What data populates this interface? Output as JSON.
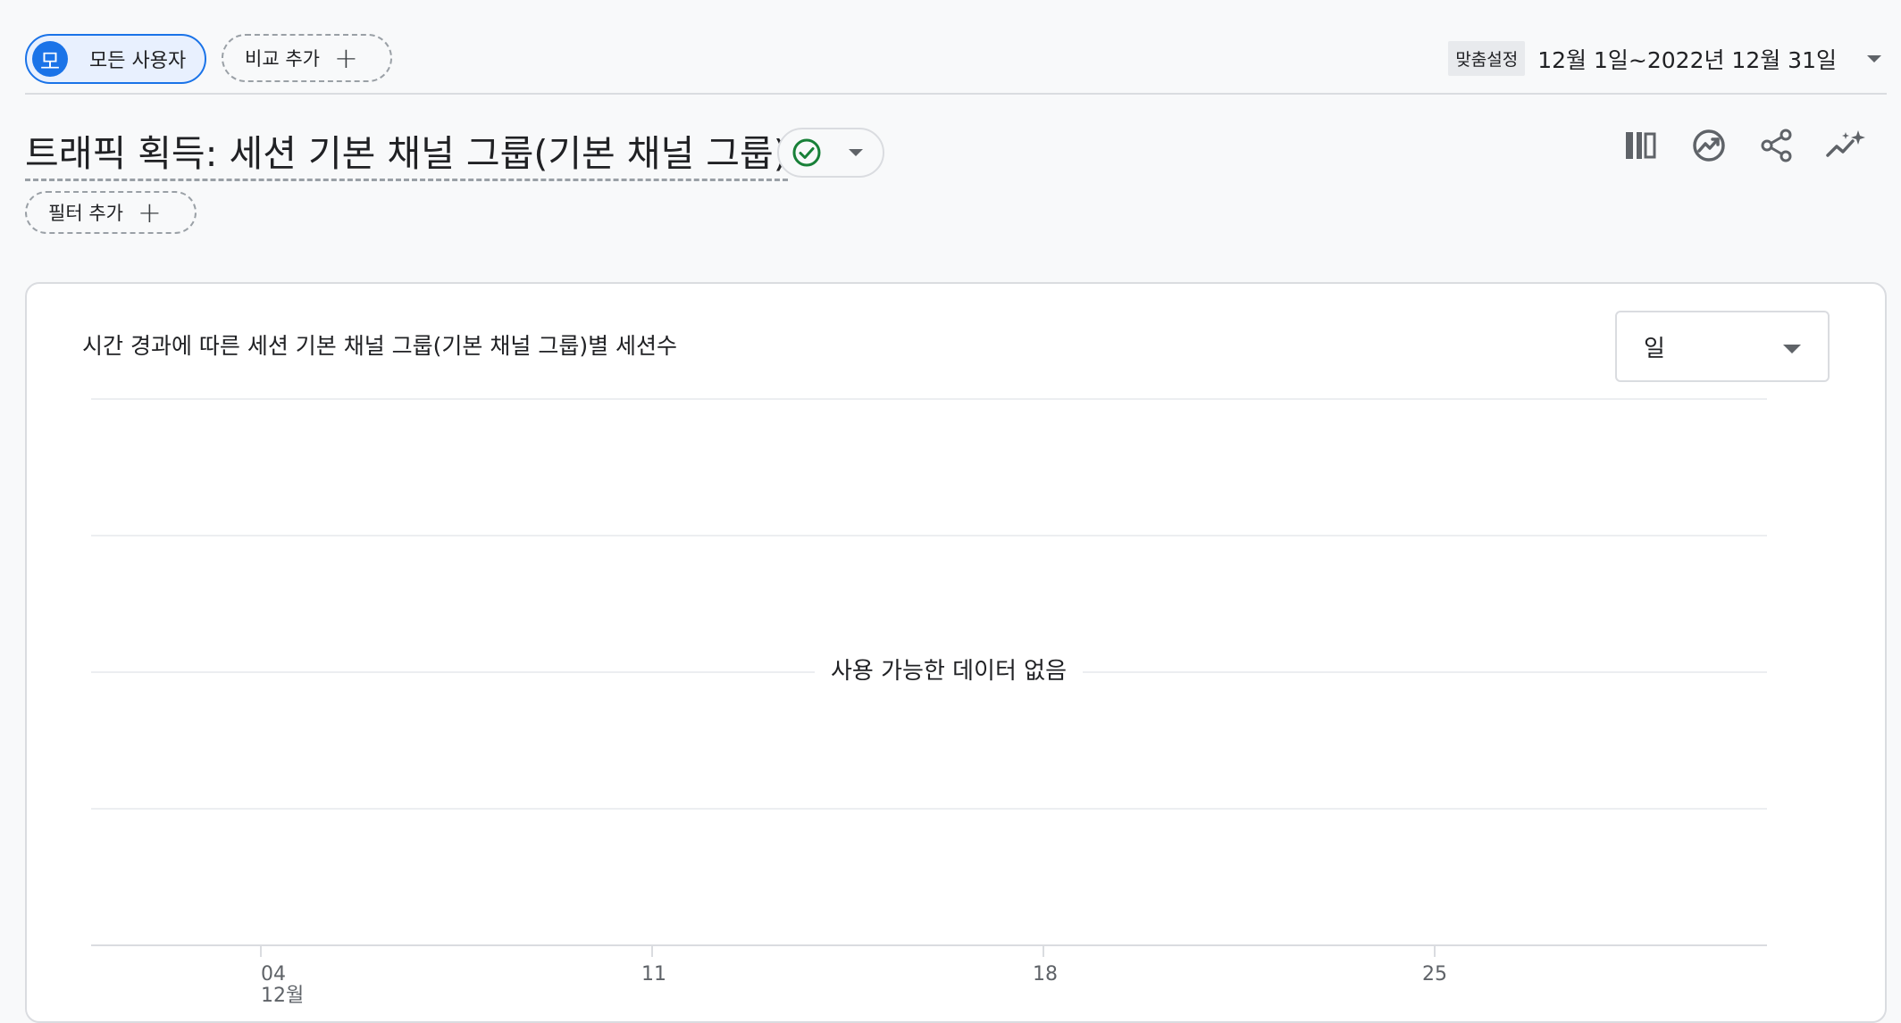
{
  "header": {
    "user_chip": {
      "avatar_letter": "모",
      "label": "모든 사용자"
    },
    "compare_chip": {
      "label": "비교 추가",
      "icon": "plus-icon"
    },
    "date_range": {
      "badge": "맞춤설정",
      "text": "12월 1일~2022년 12월 31일",
      "icon": "chevron-down-icon"
    }
  },
  "title_row": {
    "title": "트래픽 획득: 세션 기본 채널 그룹(기본 채널 그룹)",
    "status_icon": "check-circle-icon",
    "actions": [
      {
        "name": "customize-report-icon"
      },
      {
        "name": "insights-icon"
      },
      {
        "name": "share-icon"
      },
      {
        "name": "sparkle-trend-icon"
      }
    ]
  },
  "filter_chip": {
    "label": "필터 추가",
    "icon": "plus-icon"
  },
  "card": {
    "title": "시간 경과에 따른 세션 기본 채널 그룹(기본 채널 그룹)별 세션수",
    "granularity": {
      "selected": "일"
    },
    "empty_message": "사용 가능한 데이터 없음"
  },
  "chart_data": {
    "type": "line",
    "title": "시간 경과에 따른 세션 기본 채널 그룹(기본 채널 그룹)별 세션수",
    "x_ticks": [
      {
        "label": "04",
        "sublabel": "12월"
      },
      {
        "label": "11",
        "sublabel": ""
      },
      {
        "label": "18",
        "sublabel": ""
      },
      {
        "label": "25",
        "sublabel": ""
      }
    ],
    "series": [],
    "grid": true,
    "empty_message": "사용 가능한 데이터 없음"
  },
  "colors": {
    "accent": "#1a73e8",
    "accent_light": "#e8f0fe",
    "success": "#188038",
    "border": "#dadce0",
    "icon": "#5f6368"
  }
}
